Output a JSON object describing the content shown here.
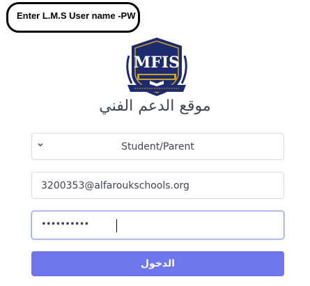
{
  "callout": {
    "text": "Enter L.M.S User name -PW"
  },
  "logo": {
    "icon": "mfis-school-crest-logo",
    "text": "MFIS"
  },
  "form": {
    "heading": "موقع الدعم الفني",
    "role_select": {
      "selected": "Student/Parent",
      "icon": "chevron-down-icon"
    },
    "username": {
      "value": "3200353@alfaroukschools.org"
    },
    "password": {
      "masked_value": "••••••••••"
    },
    "submit_label": "الدخول"
  },
  "colors": {
    "accent": "#6f75ea",
    "heading": "#3f4450",
    "border": "#d8dbe0",
    "logo_navy": "#1e2a6e",
    "logo_gold": "#c9a227"
  }
}
